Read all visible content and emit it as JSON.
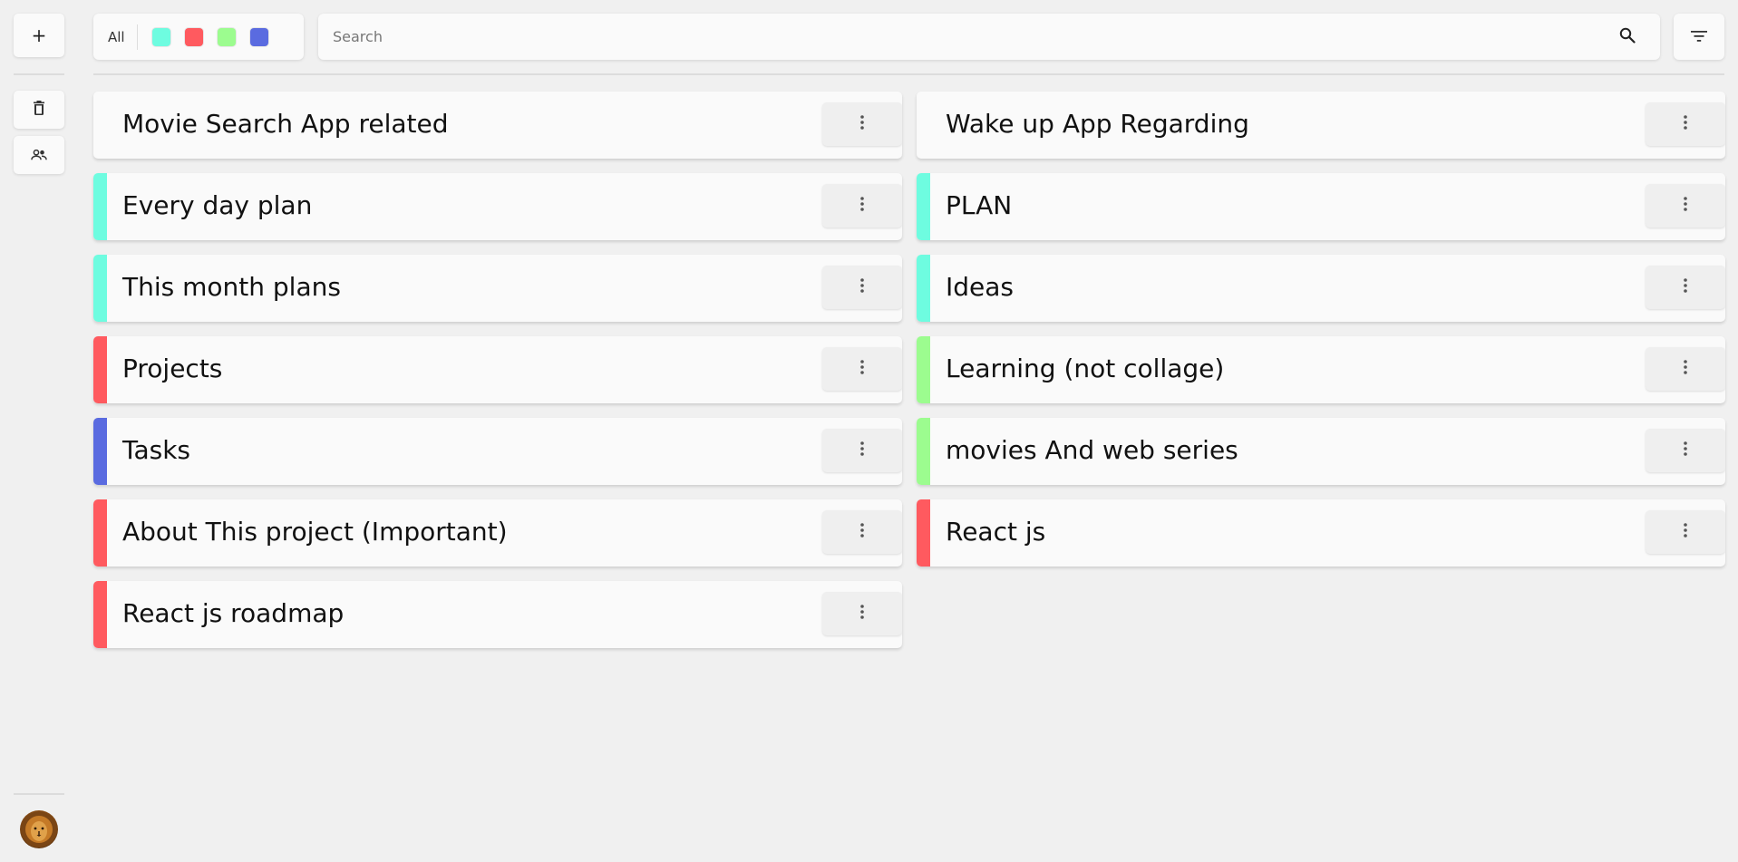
{
  "sidebar": {
    "add_label": "+",
    "trash_icon": "trash-icon",
    "people_icon": "people-icon",
    "avatar_icon": "lion-avatar"
  },
  "filter": {
    "all_label": "All",
    "colors": [
      {
        "name": "cyan",
        "hex": "#6efce0"
      },
      {
        "name": "red",
        "hex": "#ff5a5f"
      },
      {
        "name": "green",
        "hex": "#9cfc8f"
      },
      {
        "name": "blue",
        "hex": "#5a6be0"
      }
    ]
  },
  "search": {
    "placeholder": "Search",
    "value": "",
    "icon": "search-icon"
  },
  "sort_icon": "sort-filter-icon",
  "notes_left": [
    {
      "title": "Movie Search App related",
      "color": null
    },
    {
      "title": "Every day plan",
      "color": "#6efce0"
    },
    {
      "title": "This month plans",
      "color": "#6efce0"
    },
    {
      "title": "Projects",
      "color": "#ff5a5f"
    },
    {
      "title": "Tasks",
      "color": "#5a6be0"
    },
    {
      "title": "About This project (Important)",
      "color": "#ff5a5f"
    },
    {
      "title": "React js roadmap",
      "color": "#ff5a5f"
    }
  ],
  "notes_right": [
    {
      "title": "Wake up App Regarding",
      "color": null
    },
    {
      "title": "PLAN",
      "color": "#6efce0"
    },
    {
      "title": "Ideas",
      "color": "#6efce0"
    },
    {
      "title": "Learning (not collage)",
      "color": "#9cfc8f"
    },
    {
      "title": "movies And web series",
      "color": "#9cfc8f"
    },
    {
      "title": "React js",
      "color": "#ff5a5f"
    }
  ]
}
